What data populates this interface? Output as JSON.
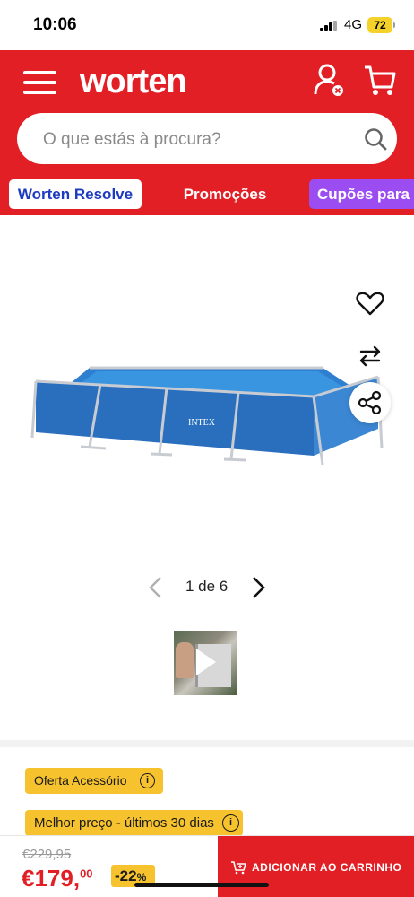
{
  "status_bar": {
    "time": "10:06",
    "network": "4G",
    "battery": "72"
  },
  "header": {
    "logo": "worten",
    "search": {
      "placeholder": "O que estás à procura?"
    },
    "chips": [
      {
        "label": "Worten Resolve"
      },
      {
        "label": "Promoções"
      },
      {
        "label": "Cupões para"
      }
    ],
    "brand_color": "#e31f26"
  },
  "gallery": {
    "pager_text": "1 de 6",
    "icons": [
      "heart-icon",
      "compare-arrows-icon",
      "share-icon",
      "play-icon"
    ]
  },
  "badges": {
    "oferta": "Oferta Acessório",
    "melhor_preco": "Melhor preço - últimos 30 dias"
  },
  "purchase": {
    "old_price": "€229,95",
    "price_main": "€179,",
    "price_cents": "00",
    "discount_value": "-22",
    "discount_unit": "%",
    "add_to_cart": "ADICIONAR AO CARRINHO"
  }
}
